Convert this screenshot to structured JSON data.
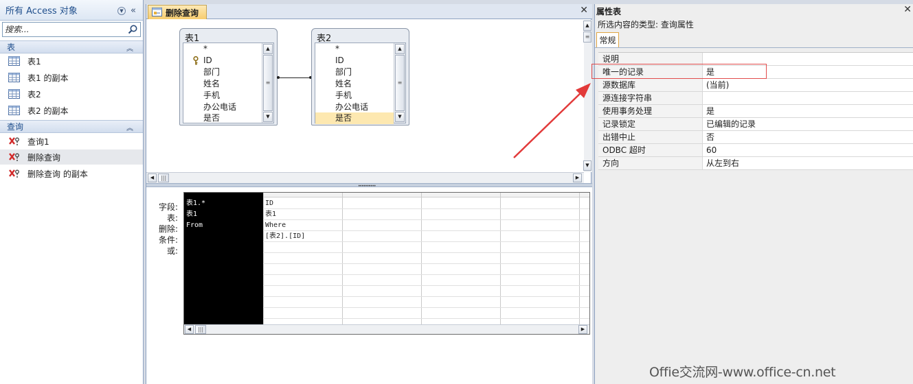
{
  "nav": {
    "title": "所有 Access 对象",
    "search_placeholder": "搜索...",
    "groups": [
      {
        "label": "表",
        "items": [
          "表1",
          "表1 的副本",
          "表2",
          "表2 的副本"
        ]
      },
      {
        "label": "查询",
        "items": [
          "查询1",
          "删除查询",
          "删除查询 的副本"
        ],
        "selected": "删除查询"
      }
    ]
  },
  "designer": {
    "tab_label": "删除查询",
    "tables": [
      {
        "title": "表1",
        "fields": [
          "*",
          "ID",
          "部门",
          "姓名",
          "手机",
          "办公电话",
          "是否"
        ],
        "key_field": "ID"
      },
      {
        "title": "表2",
        "fields": [
          "*",
          "ID",
          "部门",
          "姓名",
          "手机",
          "办公电话",
          "是否"
        ],
        "highlighted": "是否"
      }
    ],
    "grid": {
      "row_labels": [
        "字段:",
        "表:",
        "删除:",
        "条件:",
        "或:"
      ],
      "columns": [
        {
          "field": "表1.*",
          "table": "表1",
          "delete": "From",
          "criteria": ""
        },
        {
          "field": "ID",
          "table": "表1",
          "delete": "Where",
          "criteria": "[表2].[ID]"
        }
      ]
    }
  },
  "props": {
    "title": "属性表",
    "selection_type": "所选内容的类型: 查询属性",
    "tab": "常规",
    "rows": [
      {
        "name": "说明",
        "value": ""
      },
      {
        "name": "唯一的记录",
        "value": "是"
      },
      {
        "name": "源数据库",
        "value": "(当前)"
      },
      {
        "name": "源连接字符串",
        "value": ""
      },
      {
        "name": "使用事务处理",
        "value": "是"
      },
      {
        "name": "记录锁定",
        "value": "已编辑的记录"
      },
      {
        "name": "出错中止",
        "value": "否"
      },
      {
        "name": "ODBC 超时",
        "value": "60"
      },
      {
        "name": "方向",
        "value": "从左到右"
      }
    ]
  },
  "watermark": "Offie交流网-www.office-cn.net",
  "colors": {
    "highlight_box": "#e24b4b",
    "annotation_arrow": "#e23a3a",
    "active_tab": "#f7cd6f"
  }
}
